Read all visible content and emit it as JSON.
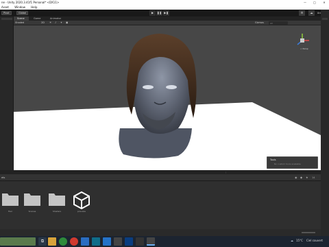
{
  "window": {
    "title": "ne - Unity 2020.3.41f1 Personal* <DX11>",
    "controls": [
      "—",
      "□",
      "✕"
    ]
  },
  "menu": [
    "Asset",
    "Window",
    "Help"
  ],
  "toolbar": {
    "left_buttons": [
      "Pivot",
      "Global"
    ],
    "play_controls": [
      "▶",
      "❚❚",
      "▶❚"
    ],
    "right_labels": [
      "Account"
    ]
  },
  "scene_tabs": [
    "Scene",
    "Game",
    "Animator"
  ],
  "scene_toolbar": {
    "shading": "Shaded",
    "mode_2d": "2D",
    "gizmos": "Gizmos",
    "search_placeholder": "All"
  },
  "gizmo": {
    "label": "< Persp"
  },
  "tools_popup": {
    "title": "Tools",
    "subtitle": "No custom tools available"
  },
  "project": {
    "tab": "ets",
    "assets": [
      {
        "name": "Hair",
        "icon": "folder-icon"
      },
      {
        "name": "Scenes",
        "icon": "folder-icon"
      },
      {
        "name": "Shaders",
        "icon": "folder-icon"
      },
      {
        "name": "preview",
        "icon": "unity-logo-icon"
      }
    ],
    "count_label": "14"
  },
  "taskbar": {
    "weather": "15°C",
    "weather_text": "Ciel couvert"
  },
  "colors": {
    "viewport_bg": "#474747",
    "plane": "#ffffff",
    "skin": "#5c6270",
    "hair": "#3e2a1c"
  }
}
